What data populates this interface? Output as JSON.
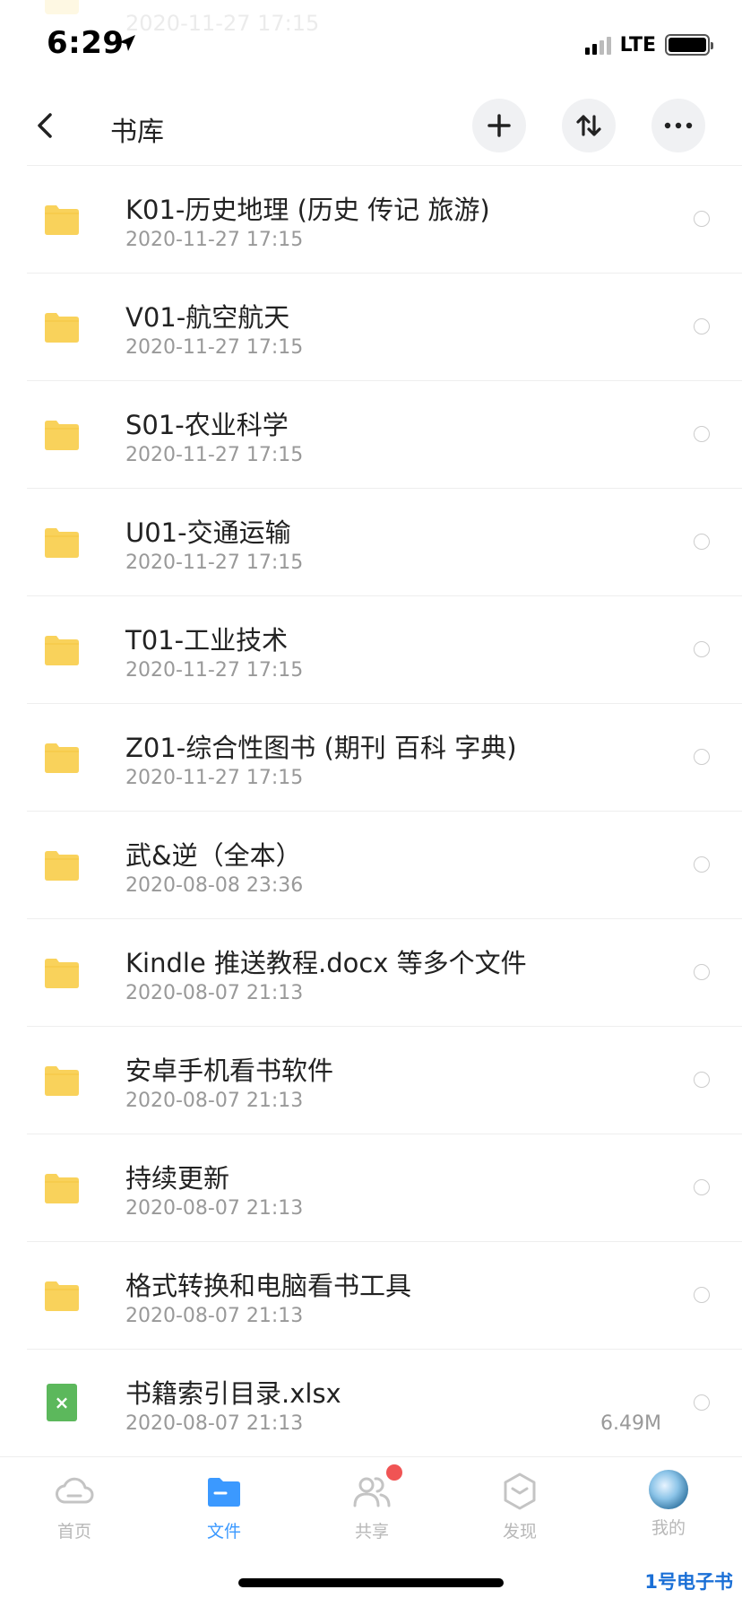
{
  "status_bar": {
    "time": "6:29",
    "network": "LTE"
  },
  "ghost_row": {
    "date": "2020-11-27 17:15"
  },
  "nav": {
    "title": "书库"
  },
  "files": [
    {
      "name": "K01-历史地理 (历史 传记 旅游)",
      "date": "2020-11-27 17:15",
      "type": "folder"
    },
    {
      "name": "V01-航空航天",
      "date": "2020-11-27 17:15",
      "type": "folder"
    },
    {
      "name": "S01-农业科学",
      "date": "2020-11-27 17:15",
      "type": "folder"
    },
    {
      "name": "U01-交通运输",
      "date": "2020-11-27 17:15",
      "type": "folder"
    },
    {
      "name": "T01-工业技术",
      "date": "2020-11-27 17:15",
      "type": "folder"
    },
    {
      "name": "Z01-综合性图书 (期刊 百科 字典)",
      "date": "2020-11-27 17:15",
      "type": "folder"
    },
    {
      "name": "武&逆（全本）",
      "date": "2020-08-08 23:36",
      "type": "folder"
    },
    {
      "name": "Kindle 推送教程.docx 等多个文件",
      "date": "2020-08-07 21:13",
      "type": "folder"
    },
    {
      "name": "安卓手机看书软件",
      "date": "2020-08-07 21:13",
      "type": "folder"
    },
    {
      "name": "持续更新",
      "date": "2020-08-07 21:13",
      "type": "folder"
    },
    {
      "name": "格式转换和电脑看书工具",
      "date": "2020-08-07 21:13",
      "type": "folder"
    },
    {
      "name": "书籍索引目录.xlsx",
      "date": "2020-08-07 21:13",
      "type": "xlsx",
      "size": "6.49M"
    }
  ],
  "tabs": [
    {
      "label": "首页",
      "icon": "cloud-icon"
    },
    {
      "label": "文件",
      "icon": "folder-icon"
    },
    {
      "label": "共享",
      "icon": "users-icon"
    },
    {
      "label": "发现",
      "icon": "hexagon-icon"
    },
    {
      "label": "我的",
      "icon": "avatar"
    }
  ],
  "watermark": "1号电子书",
  "colors": {
    "accent": "#3b99ff",
    "folder": "#f9d25b",
    "xlsx": "#5cb85c",
    "badge": "#f05454"
  }
}
